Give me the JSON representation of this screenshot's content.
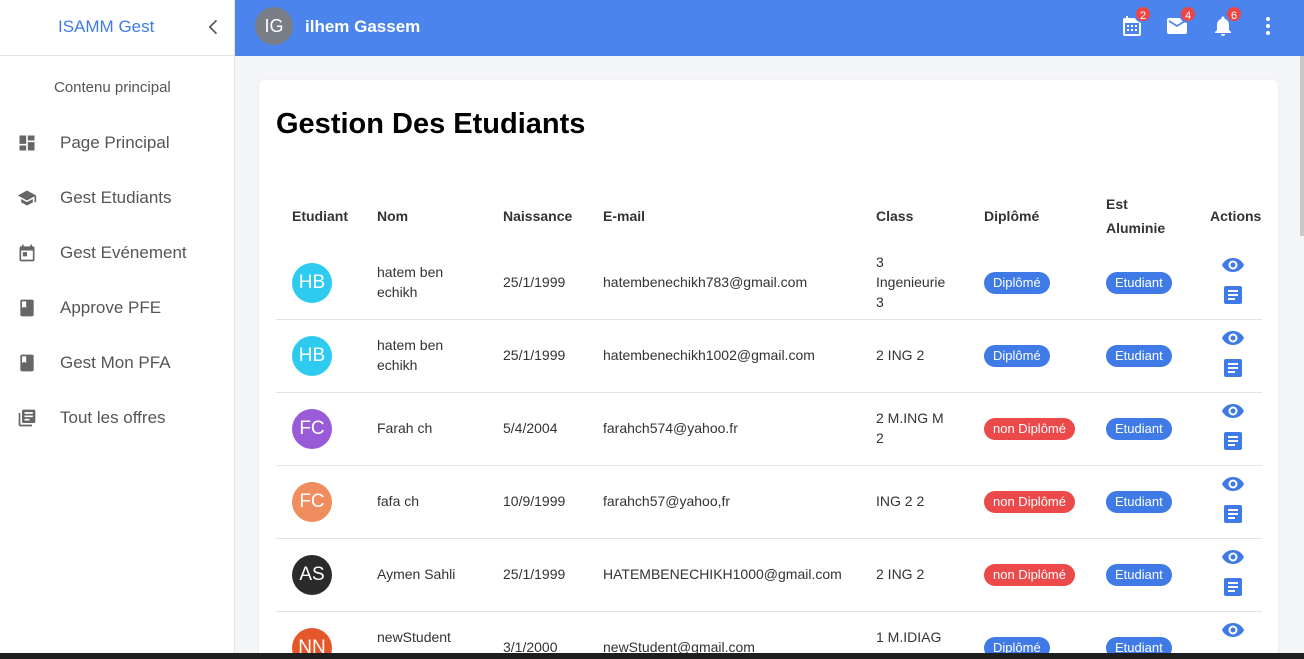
{
  "sidebar": {
    "title": "ISAMM Gest",
    "section": "Contenu principal",
    "items": [
      {
        "label": "Page Principal",
        "icon": "dashboard-icon"
      },
      {
        "label": "Gest Etudiants",
        "icon": "school-icon"
      },
      {
        "label": "Gest Evénement",
        "icon": "calendar-icon"
      },
      {
        "label": "Approve PFE",
        "icon": "book-icon"
      },
      {
        "label": "Gest Mon PFA",
        "icon": "book-icon"
      },
      {
        "label": "Tout les offres",
        "icon": "library-books-icon"
      }
    ]
  },
  "topbar": {
    "avatar_initials": "IG",
    "user_name": "ilhem Gassem",
    "calendar_count": "2",
    "mail_count": "4",
    "notif_count": "6"
  },
  "page": {
    "title": "Gestion Des Etudiants"
  },
  "table": {
    "headers": {
      "student": "Etudiant",
      "name": "Nom",
      "birth": "Naissance",
      "email": "E-mail",
      "class": "Class",
      "diploma": "Diplômé",
      "alumni_1": "Est",
      "alumni_2": "Aluminie",
      "actions": "Actions"
    },
    "rows": [
      {
        "initials": "HB",
        "avatar_color": "#2ecbf0",
        "name_1": "hatem ben",
        "name_2": "echikh",
        "birth": "25/1/1999",
        "email": "hatembenechikh783@gmail.com",
        "class_1": "3",
        "class_2": "Ingenieurie",
        "class_3": "3",
        "diploma": "Diplômé",
        "diploma_color": "#3f7ae6",
        "alumni": "Etudiant"
      },
      {
        "initials": "HB",
        "avatar_color": "#2ecbf0",
        "name_1": "hatem ben",
        "name_2": "echikh",
        "birth": "25/1/1999",
        "email": "hatembenechikh1002@gmail.com",
        "class_1": "2 ING 2",
        "class_2": "",
        "class_3": "",
        "diploma": "Diplômé",
        "diploma_color": "#3f7ae6",
        "alumni": "Etudiant"
      },
      {
        "initials": "FC",
        "avatar_color": "#9a5bd8",
        "name_1": "Farah ch",
        "name_2": "",
        "birth": "5/4/2004",
        "email": "farahch574@yahoo.fr",
        "class_1": "2 M.ING M",
        "class_2": "2",
        "class_3": "",
        "diploma": "non Diplômé",
        "diploma_color": "#ec4a4a",
        "alumni": "Etudiant"
      },
      {
        "initials": "FC",
        "avatar_color": "#f08c5e",
        "name_1": "fafa ch",
        "name_2": "",
        "birth": "10/9/1999",
        "email": "farahch57@yahoo,fr",
        "class_1": "ING 2 2",
        "class_2": "",
        "class_3": "",
        "diploma": "non Diplômé",
        "diploma_color": "#ec4a4a",
        "alumni": "Etudiant"
      },
      {
        "initials": "AS",
        "avatar_color": "#2b2b2b",
        "name_1": "Aymen Sahli",
        "name_2": "",
        "birth": "25/1/1999",
        "email": "HATEMBENECHIKH1000@gmail.com",
        "class_1": "2 ING 2",
        "class_2": "",
        "class_3": "",
        "diploma": "non Diplômé",
        "diploma_color": "#ec4a4a",
        "alumni": "Etudiant"
      },
      {
        "initials": "NN",
        "avatar_color": "#e5572b",
        "name_1": "newStudent",
        "name_2": "",
        "birth": "3/1/2000",
        "email": "newStudent@gmail.com",
        "class_1": "1 M.IDIAG",
        "class_2": "",
        "class_3": "",
        "diploma": "Diplômé",
        "diploma_color": "#3f7ae6",
        "alumni": "Etudiant"
      }
    ],
    "action_icons": [
      "eye-icon",
      "document-icon"
    ]
  },
  "colors": {
    "primary": "#4a84ec",
    "badge": "#f04545",
    "success_pill": "#3f7ae6",
    "danger_pill": "#ec4a4a"
  }
}
